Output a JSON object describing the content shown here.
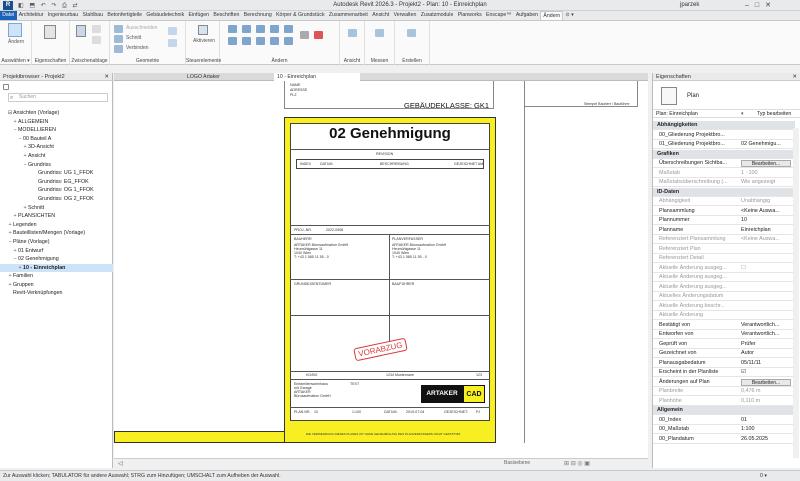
{
  "titlebar": {
    "logo": "R",
    "title": "Autodesk Revit 2026.3 - Projekt2 - Plan: 10 - Einreichplan",
    "user": "jparzek",
    "qat_icons": "◧ ⬒ ↶ ↷ ⎙ ⇄"
  },
  "tabs": [
    "Datei",
    "Architektur",
    "Ingenieurbau",
    "Stahlbau",
    "Betonfertigteile",
    "Gebäudetechnik",
    "Einfügen",
    "Beschriften",
    "Berechnung",
    "Körper & Grundstück",
    "Zusammenarbeit",
    "Ansicht",
    "Verwalten",
    "Zusatzmodule",
    "Planworks",
    "Enscape™",
    "Aufgaben",
    "Ändern",
    "⊙ ▾"
  ],
  "active_tab": "Ändern",
  "ribbon": {
    "modify_label": "Ändern",
    "groups": {
      "auswahl": "Auswählen ▾",
      "eigenschaften": "Eigenschaften",
      "zwischenablage": "Zwischenablage",
      "geometrie": "Geometrie",
      "steuerelemente": "Steuerelemente",
      "aendern": "Ändern",
      "ansicht": "Ansicht",
      "messen": "Messen",
      "erstellen": "Erstellen"
    },
    "labels": {
      "ausschneiden": "Ausschneiden",
      "schnitt": "Schnitt",
      "verbinden": "Verbinden",
      "aktivieren": "Aktivieren"
    }
  },
  "project_browser": {
    "header": "Projektbrowser - Projekt2",
    "close": "✕",
    "search_placeholder": "Suchen",
    "items": [
      {
        "exp": "⊟",
        "label": "Ansichten (Vorlage)",
        "indent": 1
      },
      {
        "exp": "+",
        "label": "ALLGEMEIN",
        "indent": 2
      },
      {
        "exp": "−",
        "label": "MODELLIEREN",
        "indent": 2
      },
      {
        "exp": "−",
        "label": "00 Bauteil A",
        "indent": 3
      },
      {
        "exp": "+",
        "label": "3D-Ansicht",
        "indent": 4
      },
      {
        "exp": "+",
        "label": "Ansicht",
        "indent": 4
      },
      {
        "exp": "−",
        "label": "Grundriss",
        "indent": 4
      },
      {
        "exp": "",
        "label": "Grundriss: UG 1_FFOK",
        "indent": 6
      },
      {
        "exp": "",
        "label": "Grundriss: EG_FFOK",
        "indent": 6
      },
      {
        "exp": "",
        "label": "Grundriss: OG 1_FFOK",
        "indent": 6
      },
      {
        "exp": "",
        "label": "Grundriss: OG 2_FFOK",
        "indent": 6
      },
      {
        "exp": "+",
        "label": "Schnitt",
        "indent": 4
      },
      {
        "exp": "+",
        "label": "PLANSICHTEN",
        "indent": 2
      },
      {
        "exp": "+",
        "label": "Legenden",
        "indent": 1
      },
      {
        "exp": "+",
        "label": "Bauteillisten/Mengen (Vorlage)",
        "indent": 1
      },
      {
        "exp": "−",
        "label": "Pläne (Vorlage)",
        "indent": 1
      },
      {
        "exp": "+",
        "label": "01 Entwurf",
        "indent": 2
      },
      {
        "exp": "−",
        "label": "02 Genehmigung",
        "indent": 2
      },
      {
        "exp": "+",
        "label": "10 - Einreichplan",
        "indent": 3,
        "selected": true
      },
      {
        "exp": "+",
        "label": "Familien",
        "indent": 1
      },
      {
        "exp": "+",
        "label": "Gruppen",
        "indent": 1
      },
      {
        "exp": "",
        "label": "Revit-Verknüpfungen",
        "indent": 1
      }
    ]
  },
  "doc_tabs": [
    {
      "label": "LOGO Artaker",
      "active": false
    },
    {
      "label": "10 - Einreichplan",
      "active": true
    }
  ],
  "sheet": {
    "top_small": [
      "NAME",
      "ADRESSE",
      "PLZ"
    ],
    "gebaeudeklasse": "GEBÄUDEKLASSE: GK1",
    "title": "02 Genehmigung",
    "revision_header": "REVISION",
    "revision_cols": [
      "INDEX",
      "DATUM",
      "BESCHREIBUNG",
      "GEZEICHNET AM"
    ],
    "projnr_label": "PROJ.-NR.",
    "projnr": "2022-0908",
    "bauherr_label": "BAUHERR",
    "planverfasser_label": "PLANVERFASSER",
    "company_lines": [
      "ARTAKER Bürosaufmation GmbH",
      "Heumühlgasse 11",
      "1040 Wien",
      "T: +43 1 585 11 55 - 0"
    ],
    "grundeigentuemer_label": "GRUNDEIGENTÜMER",
    "bauführer_label": "BAUFÜHRER",
    "stamp": "VORABZUG",
    "kg": "KG/BG",
    "gst": "1234 Musternane",
    "ez": "123",
    "project_lines": [
      "Einfamilienwohnhaus",
      "mit Garage",
      "ARTAKER",
      "Bürosaufmation GmbH"
    ],
    "text_label": "TEXT",
    "logo_a": "ARTAKER",
    "logo_b": "CAD",
    "planinfo": [
      "PLAN NR.",
      "10",
      "1:100",
      "DATUM:",
      "2019-07-04",
      "GEZEICHNET:",
      "PJ"
    ],
    "footer_note": "DIE VERWENDUNG DIESES PLANES IST OHNE GENEHMIGUNG DES PLANVERFASSERS NICHT GESTATTET",
    "rightcut_label": "Stempel Bauherr / Bauführer"
  },
  "properties": {
    "header": "Eigenschaften",
    "close": "✕",
    "type": "Plan",
    "selector": "Plan: Einreichplan",
    "edit_type": "Typ bearbeiten",
    "rows": [
      {
        "k": "Abhängigkeiten",
        "sec": true
      },
      {
        "k": "00_Gliederung Projektbro...",
        "v": ""
      },
      {
        "k": "01_Gliederung Projektbro...",
        "v": "02 Genehmigu..."
      },
      {
        "k": "Grafiken",
        "sec": true
      },
      {
        "k": "Überschreibungen Sichtba...",
        "v": "Bearbeiten...",
        "btn": true
      },
      {
        "k": "Maßstab",
        "v": "1 : 100",
        "dis": true
      },
      {
        "k": "Maßstabsüberschreibung (...",
        "v": "Wie angezeigt",
        "dis": true
      },
      {
        "k": "ID-Daten",
        "sec": true
      },
      {
        "k": "Abhängigkeit",
        "v": "Unabhängig",
        "dis": true
      },
      {
        "k": "Plansammlung",
        "v": "<Keine Auswa..."
      },
      {
        "k": "Plannummer",
        "v": "10"
      },
      {
        "k": "Planname",
        "v": "Einreichplan"
      },
      {
        "k": "Referenziert Plansammlung",
        "v": "<Keine Auswa...",
        "dis": true
      },
      {
        "k": "Referenziert Plan",
        "v": "",
        "dis": true
      },
      {
        "k": "Referenziert Detail",
        "v": "",
        "dis": true
      },
      {
        "k": "Aktuelle Änderung ausgeg...",
        "v": "☐",
        "dis": true
      },
      {
        "k": "Aktuelle Änderung ausgeg...",
        "v": "",
        "dis": true
      },
      {
        "k": "Aktuelle Änderung ausgeg...",
        "v": "",
        "dis": true
      },
      {
        "k": "Aktuelles Änderungsdatum",
        "v": "",
        "dis": true
      },
      {
        "k": "Aktuelle Änderung beschr...",
        "v": "",
        "dis": true
      },
      {
        "k": "Aktuelle Änderung",
        "v": "",
        "dis": true
      },
      {
        "k": "Bestätigt von",
        "v": "Verantwortlich..."
      },
      {
        "k": "Entworfen von",
        "v": "Verantwortlich..."
      },
      {
        "k": "Geprüft von",
        "v": "Prüfer"
      },
      {
        "k": "Gezeichnet von",
        "v": "Autor"
      },
      {
        "k": "Planausgabedatum",
        "v": "05/11/11"
      },
      {
        "k": "Erscheint in der Planliste",
        "v": "☑"
      },
      {
        "k": "Änderungen auf Plan",
        "v": "Bearbeiten...",
        "btn": true
      },
      {
        "k": "Planbreite",
        "v": "0,476 m",
        "dis": true
      },
      {
        "k": "Planhöhe",
        "v": "0,110 m",
        "dis": true
      },
      {
        "k": "Allgemein",
        "sec": true
      },
      {
        "k": "00_Index",
        "v": "01"
      },
      {
        "k": "00_Maßstab",
        "v": "1:100"
      },
      {
        "k": "00_Plandatum",
        "v": "26.05.2025"
      }
    ]
  },
  "viewbar": {
    "nav": "◁",
    "scale": "Basisebene",
    "icons": "⊞ ⊟ ◎ ▣"
  },
  "statusbar": "Zur Auswahl klicken; TABULATOR für andere Auswahl; STRG zum Hinzufügen; UMSCHALT zum Aufheben der Auswahl.",
  "statusbar_right": "0 ▾",
  "colors": {
    "file_tab": "#1a63b8",
    "accent": "#1a63b8",
    "sheet_yellow": "#f7ef21",
    "stamp": "#d63a3a",
    "logo_black": "#111111",
    "logo_yellow": "#f7ef21"
  }
}
